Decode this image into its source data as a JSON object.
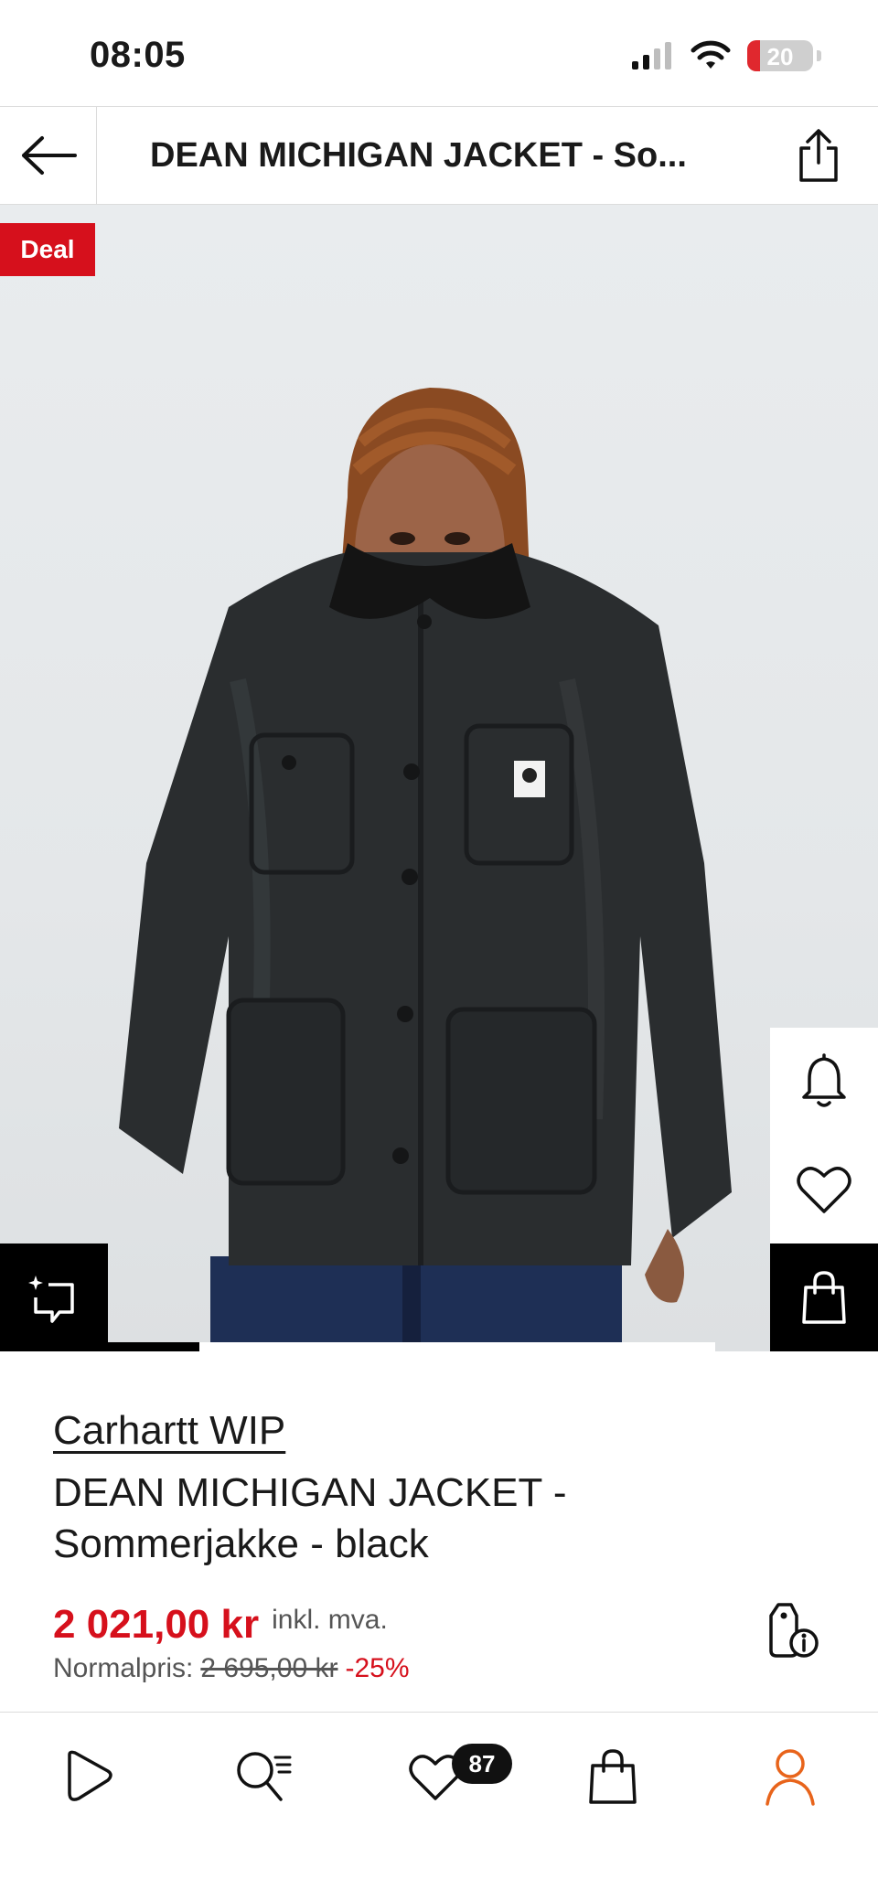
{
  "status_bar": {
    "time": "08:05",
    "battery_level": "20",
    "battery_fraction": 0.2
  },
  "header": {
    "title": "DEAN MICHIGAN JACKET - So...",
    "back_icon": "arrow-left-icon",
    "share_icon": "share-icon"
  },
  "hero": {
    "deal_label": "Deal",
    "image_description_icon": "product-photo",
    "gallery_progress": 0.15
  },
  "side_actions": {
    "notify_icon": "bell-icon",
    "wishlist_icon": "heart-icon",
    "bag_icon": "shopping-bag-icon"
  },
  "product": {
    "brand": "Carhartt WIP",
    "name": "DEAN MICHIGAN JACKET - Sommerjakke - black",
    "price": "2 021,00 kr",
    "vat_label": "inkl. mva.",
    "normal_label": "Normalpris:",
    "normal_price": "2 695,00 kr",
    "discount": "-25%"
  },
  "bottom_nav": {
    "items": [
      {
        "icon": "home-play-icon"
      },
      {
        "icon": "search-icon"
      },
      {
        "icon": "wishlist-heart-icon"
      },
      {
        "icon": "bag-icon"
      },
      {
        "icon": "profile-icon"
      }
    ],
    "wishlist_count": "87",
    "active_color": "#e8641b"
  },
  "colors": {
    "accent_red": "#d6101c",
    "active_orange": "#e8641b"
  }
}
